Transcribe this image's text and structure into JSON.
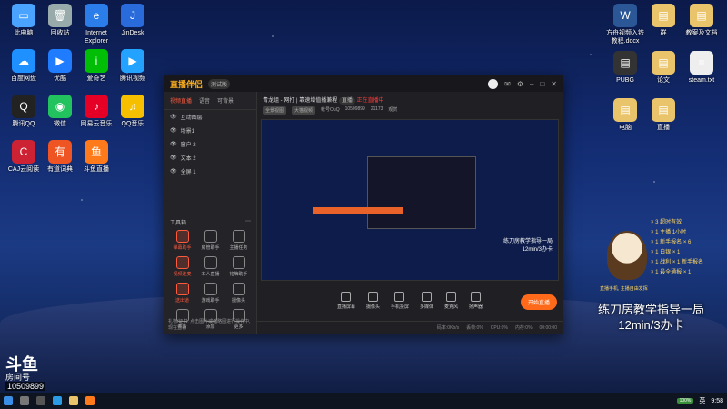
{
  "desktop": {
    "left_icons": [
      {
        "label": "此电脑",
        "color": "#4aa3ff",
        "sym": "▭"
      },
      {
        "label": "回收站",
        "color": "#9aa",
        "sym": "🗑"
      },
      {
        "label": "Internet Explorer",
        "color": "#2b7de9",
        "sym": "e"
      },
      {
        "label": "JinDesk",
        "color": "#2a6bdc",
        "sym": "J"
      },
      {
        "label": "百度网盘",
        "color": "#1e90ff",
        "sym": "☁"
      },
      {
        "label": "优酷",
        "color": "#1f7cff",
        "sym": "▶"
      },
      {
        "label": "爱奇艺",
        "color": "#00be06",
        "sym": "i"
      },
      {
        "label": "腾讯视频",
        "color": "#23a3ff",
        "sym": "▶"
      },
      {
        "label": "腾讯QQ",
        "color": "#222",
        "sym": "Q"
      },
      {
        "label": "微信",
        "color": "#22c35e",
        "sym": "◉"
      },
      {
        "label": "网易云音乐",
        "color": "#e60026",
        "sym": "♪"
      },
      {
        "label": "QQ音乐",
        "color": "#f6c000",
        "sym": "♫"
      },
      {
        "label": "CAJ云阅读",
        "color": "#c23",
        "sym": "C"
      },
      {
        "label": "有道词典",
        "color": "#e52",
        "sym": "有"
      },
      {
        "label": "斗鱼直播",
        "color": "#ff7a1a",
        "sym": "鱼"
      }
    ],
    "right_icons": [
      {
        "label": "方舟视频入铁教程.docx",
        "color": "#2b5797",
        "sym": "W"
      },
      {
        "label": "群",
        "color": "#e9c46a",
        "sym": "▤"
      },
      {
        "label": "教案及文档",
        "color": "#e9c46a",
        "sym": "▤"
      },
      {
        "label": "PUBG",
        "color": "#333",
        "sym": "▤"
      },
      {
        "label": "论文",
        "color": "#e9c46a",
        "sym": "▤"
      },
      {
        "label": "steam.txt",
        "color": "#eee",
        "sym": "≡"
      },
      {
        "label": "电脑",
        "color": "#e9c46a",
        "sym": "▤"
      },
      {
        "label": "直播",
        "color": "#e9c46a",
        "sym": "▤"
      }
    ]
  },
  "app": {
    "title": "直播伴侣",
    "version": "测试版",
    "tabs": [
      "视频直播",
      "语音",
      "可背景"
    ],
    "scenes": [
      "互动图层",
      "场景1",
      "窗户 2",
      "文本 2",
      "全屏 1"
    ],
    "room_title": "青龙组 - 网打 | 靠速增值播兼程",
    "room_tag": "直播",
    "live_label": "正在直播中",
    "stats": [
      "全景视图",
      "大猫视频",
      "帐号OuQ",
      "10509899",
      "21173",
      "观赏"
    ],
    "tools_header": "工具箱",
    "tools": [
      "弹幕助手",
      "房管助手",
      "主播任务",
      "视频连麦",
      "本人直播",
      "铭牌助手",
      "送出道",
      "游戏助手",
      "摄像头",
      "高清",
      "添加",
      "更多"
    ],
    "footer_tip": "礼物/证书: 点击图片或缩略图进行操作中, 现在查看",
    "controls": [
      "直播屏幕",
      "摄像头",
      "手机投屏",
      "多媒体",
      "麦克风",
      "扬声器"
    ],
    "start_label": "开始直播",
    "status": [
      "码率:0Kb/s",
      "丢帧:0%",
      "CPU:0%",
      "内存:0%",
      "00:00:00"
    ]
  },
  "overlay": {
    "list": [
      "× 3 超时有效",
      "× 1 主播 1小时",
      "× 1 新手报名 × 6",
      "× 1 白银 × 1",
      "× 1 战利 × 1 新手报名",
      "× 1 最全通报 × 1"
    ],
    "note": "直播手机, 主播自由发挥",
    "caption_line1": "练刀房教学指导一局",
    "caption_line2": "12min/3办卡",
    "preview_caption_line1": "练刀房教学指导一局",
    "preview_caption_line2": "12min/3办卡"
  },
  "douyu": {
    "brand": "斗鱼",
    "room": "房间号",
    "id": "10509899"
  },
  "taskbar": {
    "time": "9:58",
    "battery": "100%",
    "lang": "英"
  }
}
